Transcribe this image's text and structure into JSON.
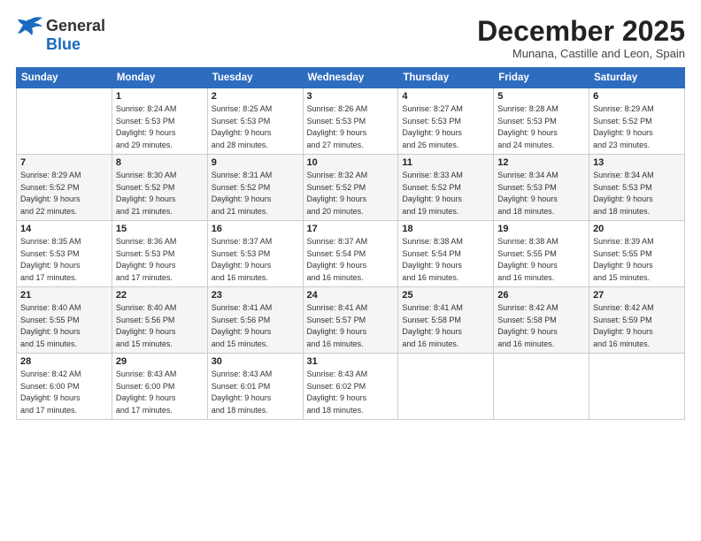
{
  "logo": {
    "general": "General",
    "blue": "Blue",
    "bird_unicode": "🐦"
  },
  "header": {
    "month": "December 2025",
    "location": "Munana, Castille and Leon, Spain"
  },
  "weekdays": [
    "Sunday",
    "Monday",
    "Tuesday",
    "Wednesday",
    "Thursday",
    "Friday",
    "Saturday"
  ],
  "weeks": [
    [
      {
        "day": "",
        "info": ""
      },
      {
        "day": "1",
        "info": "Sunrise: 8:24 AM\nSunset: 5:53 PM\nDaylight: 9 hours\nand 29 minutes."
      },
      {
        "day": "2",
        "info": "Sunrise: 8:25 AM\nSunset: 5:53 PM\nDaylight: 9 hours\nand 28 minutes."
      },
      {
        "day": "3",
        "info": "Sunrise: 8:26 AM\nSunset: 5:53 PM\nDaylight: 9 hours\nand 27 minutes."
      },
      {
        "day": "4",
        "info": "Sunrise: 8:27 AM\nSunset: 5:53 PM\nDaylight: 9 hours\nand 26 minutes."
      },
      {
        "day": "5",
        "info": "Sunrise: 8:28 AM\nSunset: 5:53 PM\nDaylight: 9 hours\nand 24 minutes."
      },
      {
        "day": "6",
        "info": "Sunrise: 8:29 AM\nSunset: 5:52 PM\nDaylight: 9 hours\nand 23 minutes."
      }
    ],
    [
      {
        "day": "7",
        "info": "Sunrise: 8:29 AM\nSunset: 5:52 PM\nDaylight: 9 hours\nand 22 minutes."
      },
      {
        "day": "8",
        "info": "Sunrise: 8:30 AM\nSunset: 5:52 PM\nDaylight: 9 hours\nand 21 minutes."
      },
      {
        "day": "9",
        "info": "Sunrise: 8:31 AM\nSunset: 5:52 PM\nDaylight: 9 hours\nand 21 minutes."
      },
      {
        "day": "10",
        "info": "Sunrise: 8:32 AM\nSunset: 5:52 PM\nDaylight: 9 hours\nand 20 minutes."
      },
      {
        "day": "11",
        "info": "Sunrise: 8:33 AM\nSunset: 5:52 PM\nDaylight: 9 hours\nand 19 minutes."
      },
      {
        "day": "12",
        "info": "Sunrise: 8:34 AM\nSunset: 5:53 PM\nDaylight: 9 hours\nand 18 minutes."
      },
      {
        "day": "13",
        "info": "Sunrise: 8:34 AM\nSunset: 5:53 PM\nDaylight: 9 hours\nand 18 minutes."
      }
    ],
    [
      {
        "day": "14",
        "info": "Sunrise: 8:35 AM\nSunset: 5:53 PM\nDaylight: 9 hours\nand 17 minutes."
      },
      {
        "day": "15",
        "info": "Sunrise: 8:36 AM\nSunset: 5:53 PM\nDaylight: 9 hours\nand 17 minutes."
      },
      {
        "day": "16",
        "info": "Sunrise: 8:37 AM\nSunset: 5:53 PM\nDaylight: 9 hours\nand 16 minutes."
      },
      {
        "day": "17",
        "info": "Sunrise: 8:37 AM\nSunset: 5:54 PM\nDaylight: 9 hours\nand 16 minutes."
      },
      {
        "day": "18",
        "info": "Sunrise: 8:38 AM\nSunset: 5:54 PM\nDaylight: 9 hours\nand 16 minutes."
      },
      {
        "day": "19",
        "info": "Sunrise: 8:38 AM\nSunset: 5:55 PM\nDaylight: 9 hours\nand 16 minutes."
      },
      {
        "day": "20",
        "info": "Sunrise: 8:39 AM\nSunset: 5:55 PM\nDaylight: 9 hours\nand 15 minutes."
      }
    ],
    [
      {
        "day": "21",
        "info": "Sunrise: 8:40 AM\nSunset: 5:55 PM\nDaylight: 9 hours\nand 15 minutes."
      },
      {
        "day": "22",
        "info": "Sunrise: 8:40 AM\nSunset: 5:56 PM\nDaylight: 9 hours\nand 15 minutes."
      },
      {
        "day": "23",
        "info": "Sunrise: 8:41 AM\nSunset: 5:56 PM\nDaylight: 9 hours\nand 15 minutes."
      },
      {
        "day": "24",
        "info": "Sunrise: 8:41 AM\nSunset: 5:57 PM\nDaylight: 9 hours\nand 16 minutes."
      },
      {
        "day": "25",
        "info": "Sunrise: 8:41 AM\nSunset: 5:58 PM\nDaylight: 9 hours\nand 16 minutes."
      },
      {
        "day": "26",
        "info": "Sunrise: 8:42 AM\nSunset: 5:58 PM\nDaylight: 9 hours\nand 16 minutes."
      },
      {
        "day": "27",
        "info": "Sunrise: 8:42 AM\nSunset: 5:59 PM\nDaylight: 9 hours\nand 16 minutes."
      }
    ],
    [
      {
        "day": "28",
        "info": "Sunrise: 8:42 AM\nSunset: 6:00 PM\nDaylight: 9 hours\nand 17 minutes."
      },
      {
        "day": "29",
        "info": "Sunrise: 8:43 AM\nSunset: 6:00 PM\nDaylight: 9 hours\nand 17 minutes."
      },
      {
        "day": "30",
        "info": "Sunrise: 8:43 AM\nSunset: 6:01 PM\nDaylight: 9 hours\nand 18 minutes."
      },
      {
        "day": "31",
        "info": "Sunrise: 8:43 AM\nSunset: 6:02 PM\nDaylight: 9 hours\nand 18 minutes."
      },
      {
        "day": "",
        "info": ""
      },
      {
        "day": "",
        "info": ""
      },
      {
        "day": "",
        "info": ""
      }
    ]
  ]
}
